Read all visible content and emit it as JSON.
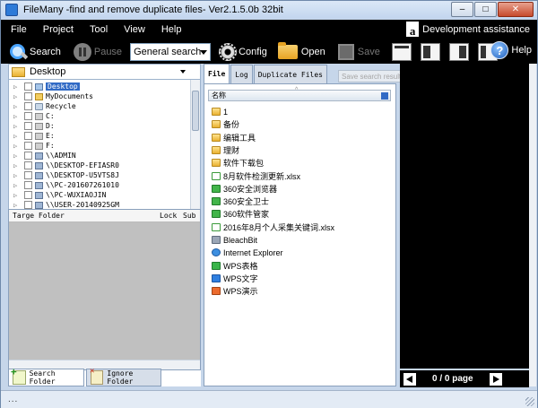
{
  "window": {
    "title": "FileMany -find and remove duplicate files- Ver2.1.5.0b 32bit",
    "min": "‒",
    "max": "□",
    "close": "✕"
  },
  "menu": {
    "items": [
      "File",
      "Project",
      "Tool",
      "View",
      "Help"
    ],
    "dev_assist": "Development assistance",
    "amazon_letter": "a"
  },
  "toolbar": {
    "search": "Search",
    "pause": "Pause",
    "mode": "General search",
    "config": "Config",
    "open": "Open",
    "save": "Save",
    "help": "Help",
    "help_glyph": "?"
  },
  "left": {
    "drive": "Desktop",
    "tree": [
      {
        "label": "Desktop",
        "icon": "desktop",
        "selected": true
      },
      {
        "label": "MyDocuments",
        "icon": "folder"
      },
      {
        "label": "Recycle",
        "icon": "bin"
      },
      {
        "label": "C:",
        "icon": "drive"
      },
      {
        "label": "D:",
        "icon": "drive"
      },
      {
        "label": "E:",
        "icon": "drive"
      },
      {
        "label": "F:",
        "icon": "drive"
      },
      {
        "label": "\\\\ADMIN",
        "icon": "net"
      },
      {
        "label": "\\\\DESKTOP-EFIASR0",
        "icon": "net"
      },
      {
        "label": "\\\\DESKTOP-U5VTS8J",
        "icon": "net"
      },
      {
        "label": "\\\\PC-201607261010",
        "icon": "net"
      },
      {
        "label": "\\\\PC-WUXIAOJIN",
        "icon": "net"
      },
      {
        "label": "\\\\USER-20140925GM",
        "icon": "net"
      }
    ],
    "target_head": {
      "folder": "Targe Folder",
      "lock": "Lock",
      "sub": "Sub"
    },
    "tabs": {
      "search_folder": "Search Folder",
      "ignore_folder": "Ignore Folder"
    }
  },
  "middle": {
    "tabs": [
      "File",
      "Log",
      "Duplicate Files"
    ],
    "save_results": "Save search results",
    "column": "名称",
    "files": [
      {
        "name": "1",
        "icon": "folder"
      },
      {
        "name": "备份",
        "icon": "folder"
      },
      {
        "name": "编辑工具",
        "icon": "folder"
      },
      {
        "name": "理财",
        "icon": "folder"
      },
      {
        "name": "软件下载包",
        "icon": "folder"
      },
      {
        "name": "8月软件检测更新.xlsx",
        "icon": "xlsx"
      },
      {
        "name": "360安全浏览器",
        "icon": "app-green"
      },
      {
        "name": "360安全卫士",
        "icon": "app-green"
      },
      {
        "name": "360软件管家",
        "icon": "app-green"
      },
      {
        "name": "2016年8月个人采集关键词.xlsx",
        "icon": "xlsx"
      },
      {
        "name": "BleachBit",
        "icon": "app-gray"
      },
      {
        "name": "Internet Explorer",
        "icon": "ie"
      },
      {
        "name": "WPS表格",
        "icon": "wps-g"
      },
      {
        "name": "WPS文字",
        "icon": "wps-b"
      },
      {
        "name": "WPS演示",
        "icon": "wps-o"
      }
    ]
  },
  "pager": {
    "text": "0 / 0 page"
  },
  "status": {
    "text": "..."
  }
}
